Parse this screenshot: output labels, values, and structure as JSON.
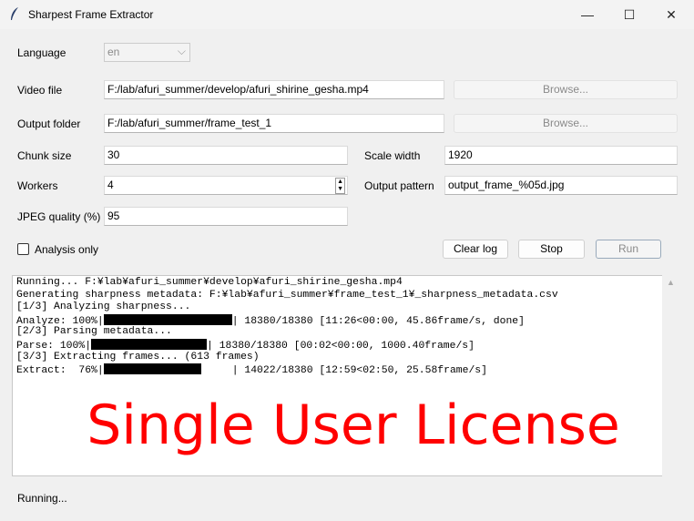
{
  "window": {
    "title": "Sharpest Frame Extractor",
    "minimize": "—",
    "maximize": "☐",
    "close": "✕"
  },
  "form": {
    "language": {
      "label": "Language",
      "value": "en"
    },
    "video_file": {
      "label": "Video file",
      "value": "F:/lab/afuri_summer/develop/afuri_shirine_gesha.mp4",
      "browse": "Browse..."
    },
    "output_folder": {
      "label": "Output folder",
      "value": "F:/lab/afuri_summer/frame_test_1",
      "browse": "Browse..."
    },
    "chunk_size": {
      "label": "Chunk size",
      "value": "30"
    },
    "scale_width": {
      "label": "Scale width",
      "value": "1920"
    },
    "workers": {
      "label": "Workers",
      "value": "4"
    },
    "output_pattern": {
      "label": "Output pattern",
      "value": "output_frame_%05d.jpg"
    },
    "jpeg_quality": {
      "label": "JPEG quality (%)",
      "value": "95"
    },
    "analysis_only": {
      "label": "Analysis only",
      "checked": false
    }
  },
  "buttons": {
    "clear_log": "Clear log",
    "stop": "Stop",
    "run": "Run"
  },
  "log": {
    "lines": [
      "Running... F:¥lab¥afuri_summer¥develop¥afuri_shirine_gesha.mp4",
      "Generating sharpness metadata: F:¥lab¥afuri_summer¥frame_test_1¥_sharpness_metadata.csv",
      "[1/3] Analyzing sharpness...",
      "[2/3] Parsing metadata...",
      "[3/3] Extracting frames... (613 frames)"
    ],
    "progress": [
      {
        "prefix": "Analyze: 100%|",
        "percent": 100,
        "suffix": "| 18380/18380 [11:26<00:00, 45.86frame/s, done]"
      },
      {
        "prefix": "Parse: 100%|",
        "percent": 100,
        "suffix": "| 18380/18380 [00:02<00:00, 1000.40frame/s]"
      },
      {
        "prefix": "Extract:  76%|",
        "percent": 76,
        "suffix": "| 14022/18380 [12:59<02:50, 25.58frame/s]"
      }
    ]
  },
  "watermark": "Single User License",
  "status": "Running..."
}
